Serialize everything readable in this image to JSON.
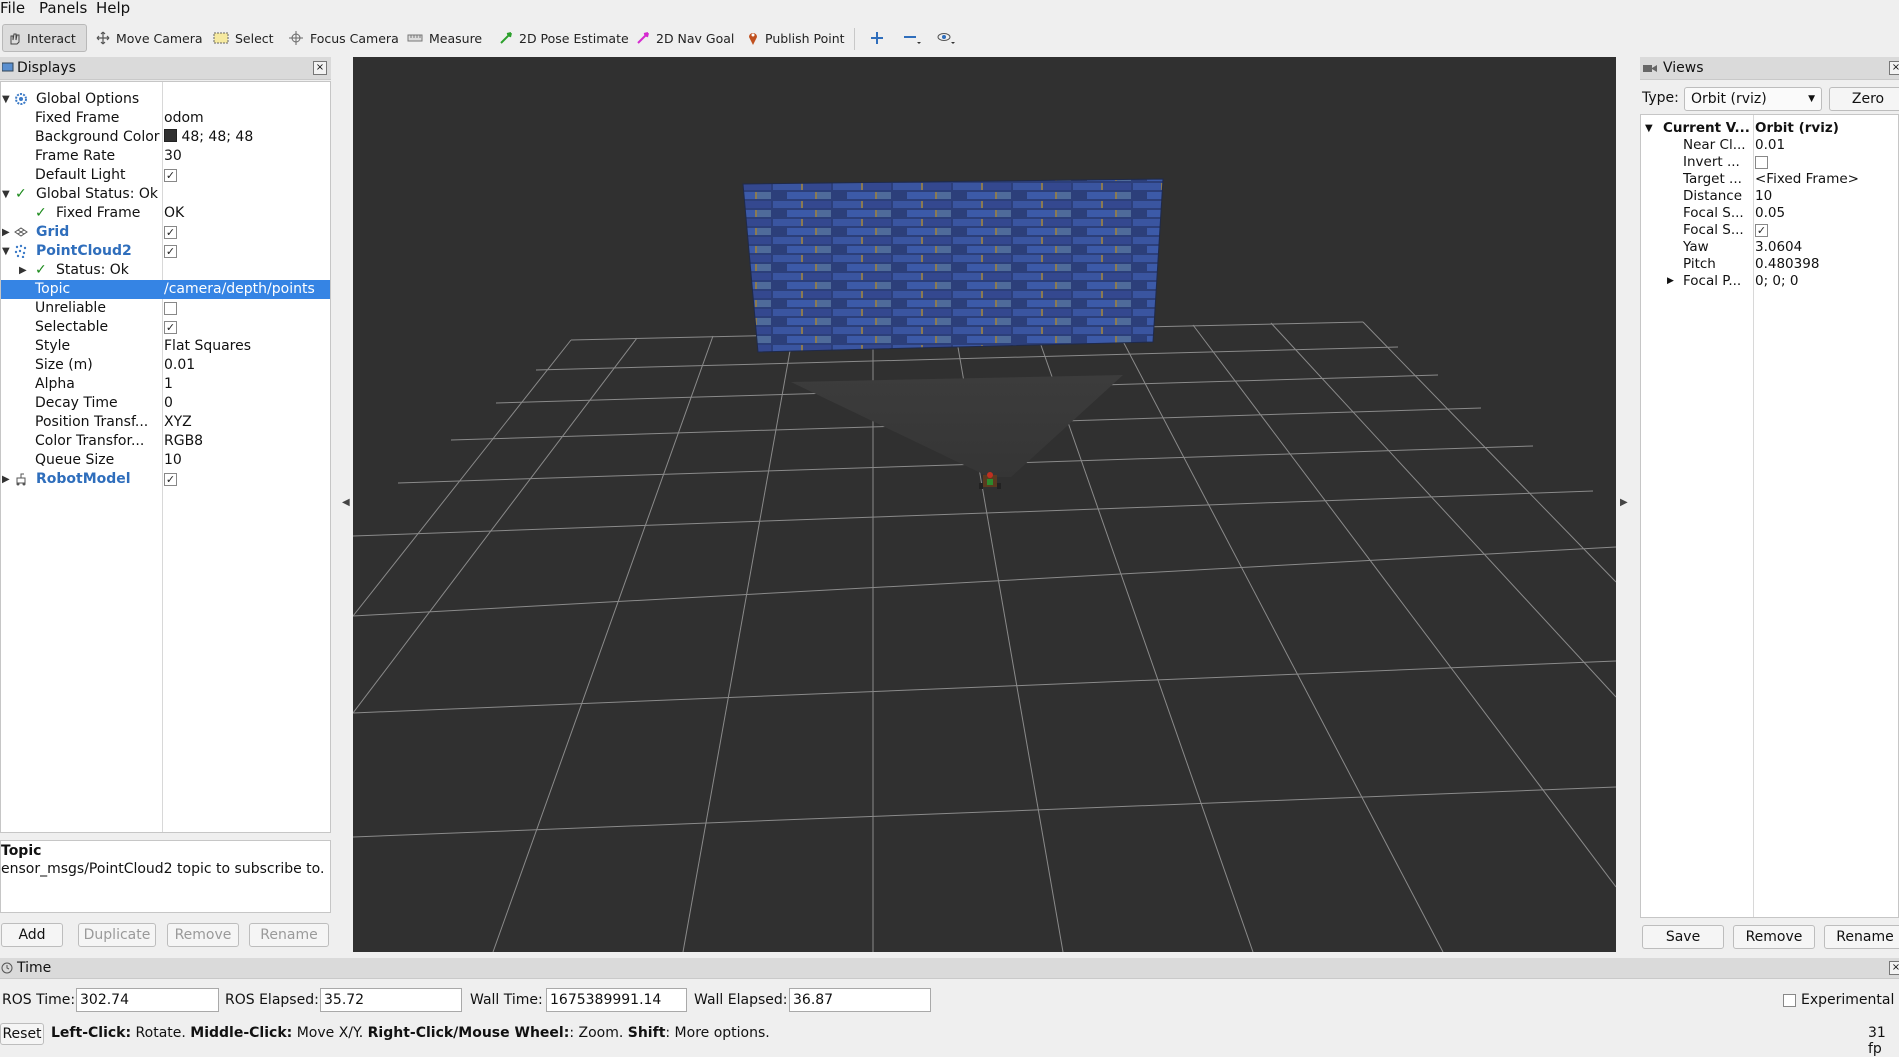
{
  "menu": [
    "File",
    "Panels",
    "Help"
  ],
  "toolbar": {
    "tools": [
      "Interact",
      "Move Camera",
      "Select",
      "Focus Camera",
      "Measure",
      "2D Pose Estimate",
      "2D Nav Goal",
      "Publish Point"
    ],
    "active": "Interact"
  },
  "displays": {
    "title": "Displays",
    "rows": [
      {
        "key": "Global Options",
        "value": ""
      },
      {
        "key": "Fixed Frame",
        "value": "odom"
      },
      {
        "key": "Background Color",
        "value": "48; 48; 48"
      },
      {
        "key": "Frame Rate",
        "value": "30"
      },
      {
        "key": "Default Light",
        "value": ""
      },
      {
        "key": "Global Status: Ok",
        "value": ""
      },
      {
        "key": "Fixed Frame",
        "value": "OK"
      },
      {
        "key": "Grid",
        "value": ""
      },
      {
        "key": "PointCloud2",
        "value": ""
      },
      {
        "key": "Status: Ok",
        "value": ""
      },
      {
        "key": "Topic",
        "value": "/camera/depth/points"
      },
      {
        "key": "Unreliable",
        "value": ""
      },
      {
        "key": "Selectable",
        "value": ""
      },
      {
        "key": "Style",
        "value": "Flat Squares"
      },
      {
        "key": "Size (m)",
        "value": "0.01"
      },
      {
        "key": "Alpha",
        "value": "1"
      },
      {
        "key": "Decay Time",
        "value": "0"
      },
      {
        "key": "Position Transf...",
        "value": "XYZ"
      },
      {
        "key": "Color Transfor...",
        "value": "RGB8"
      },
      {
        "key": "Queue Size",
        "value": "10"
      },
      {
        "key": "RobotModel",
        "value": ""
      }
    ],
    "desc_title": "Topic",
    "desc_text": "ensor_msgs/PointCloud2 topic to subscribe to.",
    "buttons": [
      "Add",
      "Duplicate",
      "Remove",
      "Rename"
    ]
  },
  "views": {
    "title": "Views",
    "type_label": "Type:",
    "type_value": "Orbit (rviz)",
    "zero": "Zero",
    "rows": [
      {
        "key": "Current V...",
        "value": "Orbit (rviz)"
      },
      {
        "key": "Near Cl...",
        "value": "0.01"
      },
      {
        "key": "Invert ...",
        "value": ""
      },
      {
        "key": "Target ...",
        "value": "<Fixed Frame>"
      },
      {
        "key": "Distance",
        "value": "10"
      },
      {
        "key": "Focal S...",
        "value": "0.05"
      },
      {
        "key": "Focal S...",
        "value": ""
      },
      {
        "key": "Yaw",
        "value": "3.0604"
      },
      {
        "key": "Pitch",
        "value": "0.480398"
      },
      {
        "key": "Focal P...",
        "value": "0; 0; 0"
      }
    ],
    "buttons": [
      "Save",
      "Remove",
      "Rename"
    ]
  },
  "time": {
    "title": "Time",
    "ros_time_label": "ROS Time:",
    "ros_time": "302.74",
    "ros_elapsed_label": "ROS Elapsed:",
    "ros_elapsed": "35.72",
    "wall_time_label": "Wall Time:",
    "wall_time": "1675389991.14",
    "wall_elapsed_label": "Wall Elapsed:",
    "wall_elapsed": "36.87",
    "experimental": "Experimental"
  },
  "status": {
    "reset": "Reset",
    "help_b1": "Left-Click:",
    "help_t1": " Rotate. ",
    "help_b2": "Middle-Click:",
    "help_t2": " Move X/Y. ",
    "help_b3": "Right-Click/Mouse Wheel:",
    "help_t3": ": Zoom. ",
    "help_b4": "Shift",
    "help_t4": ": More options.",
    "fps": "31 fp"
  },
  "colors": {
    "viewport_bg": "#303030",
    "selection": "#3584e4",
    "link_blue": "#2f6ebc",
    "ok_green": "#1b8a1b"
  }
}
